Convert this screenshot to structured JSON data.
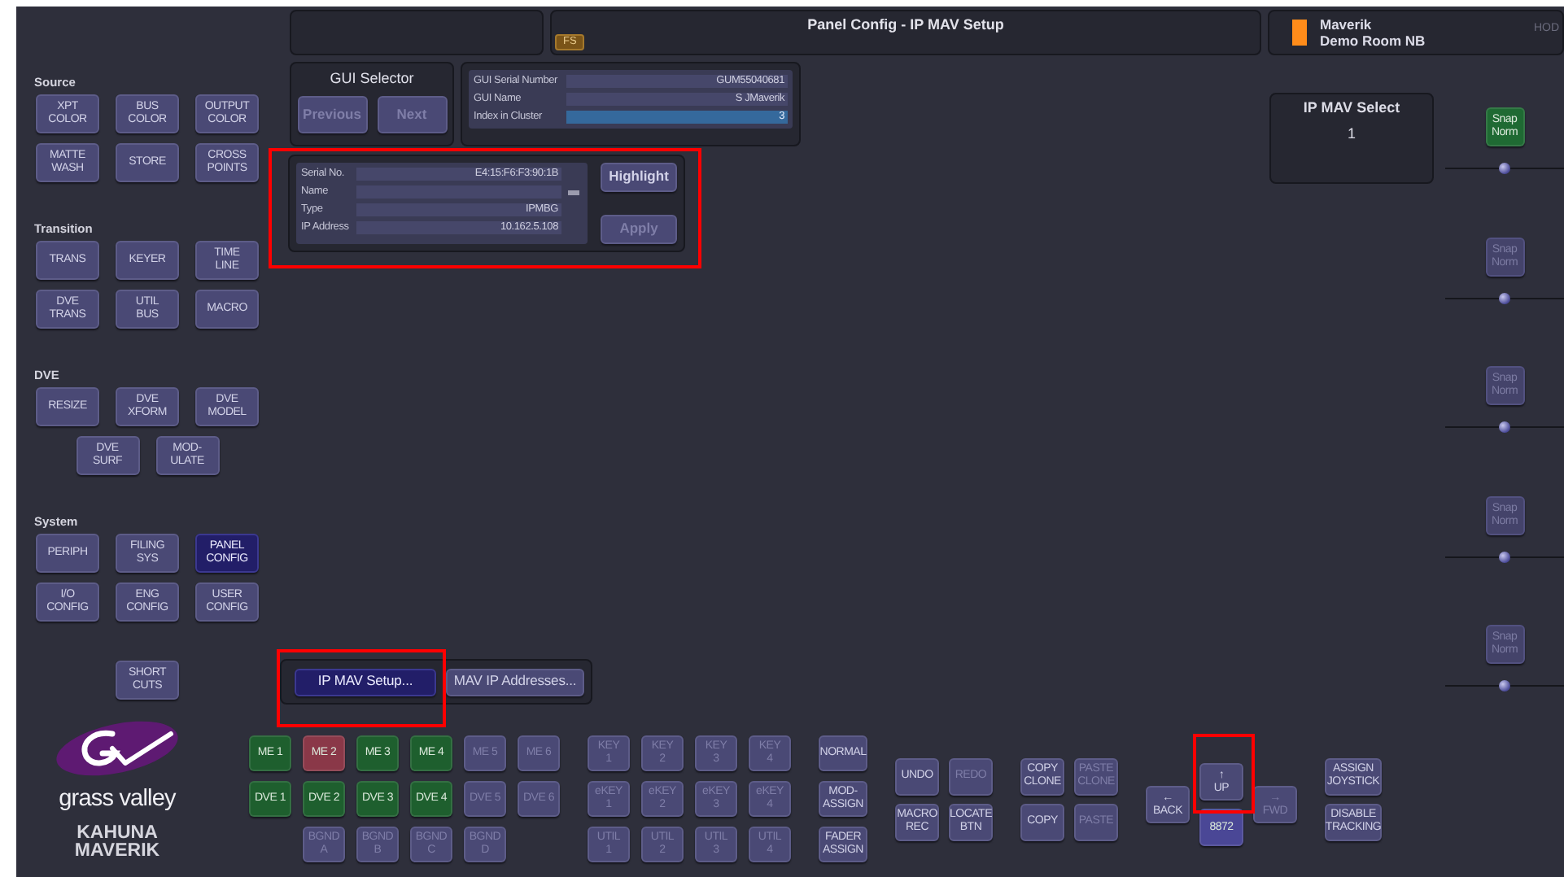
{
  "header": {
    "title": "Panel Config - IP MAV Setup",
    "badge": "FS",
    "panel_name": "Maverik",
    "room": "Demo Room NB",
    "corner_text": "HOD"
  },
  "sidebar": {
    "sections": [
      {
        "label": "Source",
        "rows": [
          [
            {
              "label": "XPT\nCOLOR",
              "selected": false
            },
            {
              "label": "BUS\nCOLOR",
              "selected": false
            },
            {
              "label": "OUTPUT\nCOLOR",
              "selected": false
            }
          ],
          [
            {
              "label": "MATTE\nWASH",
              "selected": false
            },
            {
              "label": "STORE",
              "selected": false
            },
            {
              "label": "CROSS\nPOINTS",
              "selected": false
            }
          ]
        ]
      },
      {
        "label": "Transition",
        "rows": [
          [
            {
              "label": "TRANS",
              "selected": false
            },
            {
              "label": "KEYER",
              "selected": false
            },
            {
              "label": "TIME\nLINE",
              "selected": false
            }
          ],
          [
            {
              "label": "DVE\nTRANS",
              "selected": false
            },
            {
              "label": "UTIL\nBUS",
              "selected": false
            },
            {
              "label": "MACRO",
              "selected": false
            }
          ]
        ]
      },
      {
        "label": "DVE",
        "rows": [
          [
            {
              "label": "RESIZE",
              "selected": false
            },
            {
              "label": "DVE\nXFORM",
              "selected": false
            },
            {
              "label": "DVE\nMODEL",
              "selected": false
            }
          ],
          [
            {
              "label": "DVE\nSURF",
              "selected": false
            },
            {
              "label": "MOD-\nULATE",
              "selected": false
            }
          ]
        ]
      },
      {
        "label": "System",
        "rows": [
          [
            {
              "label": "PERIPH",
              "selected": false
            },
            {
              "label": "FILING\nSYS",
              "selected": false
            },
            {
              "label": "PANEL\nCONFIG",
              "selected": true
            }
          ],
          [
            {
              "label": "I/O\nCONFIG",
              "selected": false
            },
            {
              "label": "ENG\nCONFIG",
              "selected": false
            },
            {
              "label": "USER\nCONFIG",
              "selected": false
            }
          ]
        ]
      },
      {
        "rows": [
          [
            {
              "label": "SHORT\nCUTS",
              "selected": false
            }
          ]
        ]
      }
    ]
  },
  "gui_selector": {
    "title": "GUI Selector",
    "buttons": [
      {
        "label": "Previous",
        "disabled": true
      },
      {
        "label": "Next",
        "disabled": true
      }
    ]
  },
  "gui_info": {
    "rows": [
      {
        "label": "GUI Serial Number",
        "value": "GUM55040681",
        "highlighted": false
      },
      {
        "label": "GUI Name",
        "value": "S JMaverik",
        "highlighted": false
      },
      {
        "label": "Index in Cluster",
        "value": "3",
        "highlighted": true
      }
    ]
  },
  "device": {
    "rows": [
      {
        "label": "Serial No.",
        "value": "E4:15:F6:F3:90:1B",
        "indicator": false
      },
      {
        "label": "Name",
        "indicator": true
      },
      {
        "label": "Type",
        "value": "IPMBG",
        "indicator": false
      },
      {
        "label": "IP Address",
        "value": "10.162.5.108",
        "indicator": false
      }
    ],
    "buttons": [
      {
        "label": "Highlight",
        "disabled": false
      },
      {
        "label": "Apply",
        "disabled": true
      }
    ]
  },
  "ip_mav_select": {
    "title": "IP MAV Select",
    "value": "1"
  },
  "snap_controls": [
    {
      "label": "Snap\nNorm",
      "on": true,
      "level": 0.5
    },
    {
      "label": "Snap\nNorm",
      "on": false,
      "level": 0.5
    },
    {
      "label": "Snap\nNorm",
      "on": false,
      "level": 0.5
    },
    {
      "label": "Snap\nNorm",
      "on": false,
      "level": 0.5
    },
    {
      "label": "Snap\nNorm",
      "on": false,
      "level": 0.5
    }
  ],
  "tabs": [
    {
      "label": "IP MAV Setup...",
      "selected": true
    },
    {
      "label": "MAV IP Addresses...",
      "selected": false
    }
  ],
  "logo": {
    "brand": "grass valley",
    "product": "KAHUNA\nMAVERIK"
  },
  "bottom_groups": [
    {
      "kind": "grid",
      "rows": [
        [
          {
            "label": "ME 1",
            "disabled": false,
            "color": "#1e5f2e"
          },
          {
            "label": "ME 2",
            "disabled": false,
            "color": "#8a3848"
          },
          {
            "label": "ME 3",
            "disabled": false,
            "color": "#1e5f2e"
          },
          {
            "label": "ME 4",
            "disabled": false,
            "color": "#1e5f2e"
          },
          {
            "label": "ME 5",
            "disabled": true
          },
          {
            "label": "ME 6",
            "disabled": true
          }
        ],
        [
          {
            "label": "DVE 1",
            "disabled": false,
            "color": "#1e5f2e"
          },
          {
            "label": "DVE 2",
            "disabled": false,
            "color": "#1e5f2e"
          },
          {
            "label": "DVE 3",
            "disabled": false,
            "color": "#1e5f2e"
          },
          {
            "label": "DVE 4",
            "disabled": false,
            "color": "#1e5f2e"
          },
          {
            "label": "DVE 5",
            "disabled": true
          },
          {
            "label": "DVE 6",
            "disabled": true
          }
        ],
        [
          "",
          {
            "label": "BGND\nA",
            "disabled": true
          },
          {
            "label": "BGND\nB",
            "disabled": true
          },
          {
            "label": "BGND\nC",
            "disabled": true
          },
          {
            "label": "BGND\nD",
            "disabled": true
          },
          ""
        ]
      ]
    },
    {
      "kind": "grid",
      "rows": [
        [
          {
            "label": "KEY\n1",
            "disabled": true
          },
          {
            "label": "KEY\n2",
            "disabled": true
          },
          {
            "label": "KEY\n3",
            "disabled": true
          },
          {
            "label": "KEY\n4",
            "disabled": true
          }
        ],
        [
          {
            "label": "eKEY\n1",
            "disabled": true
          },
          {
            "label": "eKEY\n2",
            "disabled": true
          },
          {
            "label": "eKEY\n3",
            "disabled": true
          },
          {
            "label": "eKEY\n4",
            "disabled": true
          }
        ],
        [
          {
            "label": "UTIL\n1",
            "disabled": true
          },
          {
            "label": "UTIL\n2",
            "disabled": true
          },
          {
            "label": "UTIL\n3",
            "disabled": true
          },
          {
            "label": "UTIL\n4",
            "disabled": true
          }
        ]
      ]
    },
    {
      "kind": "grid",
      "rows": [
        [
          {
            "label": "NORMAL",
            "disabled": false
          }
        ],
        [
          {
            "label": "MOD-\nASSIGN",
            "disabled": false
          }
        ],
        [
          {
            "label": "FADER\nASSIGN",
            "disabled": false
          }
        ]
      ]
    },
    {
      "kind": "grid",
      "rows": [
        [
          {
            "label": "UNDO",
            "disabled": false
          },
          {
            "label": "REDO",
            "disabled": true
          }
        ],
        [
          {
            "label": "MACRO\nREC",
            "disabled": false
          },
          {
            "label": "LOCATE\nBTN",
            "disabled": false
          }
        ]
      ]
    },
    {
      "kind": "grid",
      "rows": [
        [
          {
            "label": "COPY\nCLONE",
            "disabled": false
          },
          {
            "label": "PASTE\nCLONE",
            "disabled": true
          }
        ],
        [
          {
            "label": "COPY",
            "disabled": false
          },
          {
            "label": "PASTE",
            "disabled": true
          }
        ]
      ]
    },
    {
      "kind": "cross",
      "buttons": [
        {
          "label": "←\nBACK",
          "disabled": false
        },
        {
          "label": "↑\nUP",
          "disabled": false
        },
        {
          "label": "→\nFWD",
          "disabled": true
        },
        {
          "label": "8872",
          "disabled": false,
          "color": "#4a4796"
        }
      ]
    },
    {
      "kind": "grid",
      "rows": [
        [
          {
            "label": "ASSIGN\nJOYSTICK",
            "disabled": false
          }
        ],
        [
          {
            "label": "DISABLE\nTRACKING",
            "disabled": false
          }
        ]
      ]
    }
  ]
}
